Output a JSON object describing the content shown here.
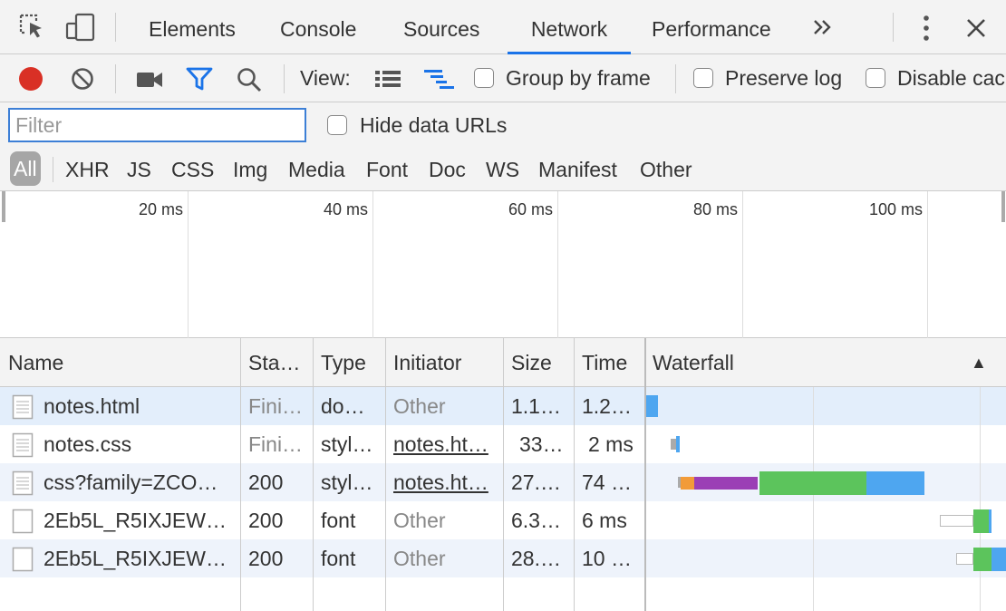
{
  "tabs": [
    {
      "label": "Elements"
    },
    {
      "label": "Console"
    },
    {
      "label": "Sources"
    },
    {
      "label": "Network",
      "active": true
    },
    {
      "label": "Performance"
    }
  ],
  "toolbar": {
    "view_label": "View:",
    "group_by_frame": "Group by frame",
    "preserve_log": "Preserve log",
    "disable_cache": "Disable cac"
  },
  "filter": {
    "placeholder": "Filter",
    "hide_data_urls": "Hide data URLs",
    "types": [
      "All",
      "XHR",
      "JS",
      "CSS",
      "Img",
      "Media",
      "Font",
      "Doc",
      "WS",
      "Manifest",
      "Other"
    ],
    "active_type": "All"
  },
  "overview": {
    "ticks": [
      "20 ms",
      "40 ms",
      "60 ms",
      "80 ms",
      "100 ms"
    ]
  },
  "table": {
    "columns": [
      "Name",
      "Sta…",
      "Type",
      "Initiator",
      "Size",
      "Time",
      "Waterfall"
    ],
    "sort_indicator": "▲",
    "rows": [
      {
        "name": "notes.html",
        "status": "Fini…",
        "type": "do…",
        "initiator": "Other",
        "size": "1.1…",
        "time": "1.2…"
      },
      {
        "name": "notes.css",
        "status": "Fini…",
        "type": "styl…",
        "initiator": "notes.ht…",
        "size": "33…",
        "time": "2 ms"
      },
      {
        "name": "css?family=ZCO…",
        "status": "200",
        "type": "styl…",
        "initiator": "notes.ht…",
        "size": "27.…",
        "time": "74 …"
      },
      {
        "name": "2Eb5L_R5IXJEW…",
        "status": "200",
        "type": "font",
        "initiator": "Other",
        "size": "6.3…",
        "time": "6 ms"
      },
      {
        "name": "2Eb5L_R5IXJEW…",
        "status": "200",
        "type": "font",
        "initiator": "Other",
        "size": "28.…",
        "time": "10 …"
      }
    ]
  },
  "colors": {
    "accent": "#1a73e8",
    "record": "#d93025",
    "waterfall_blue": "#4ea6f0",
    "waterfall_green": "#5cc45c",
    "waterfall_purple": "#9b3fb5",
    "waterfall_orange": "#f29b38",
    "selected_row": "#e3eefb",
    "alt_row": "#eef3fb"
  }
}
